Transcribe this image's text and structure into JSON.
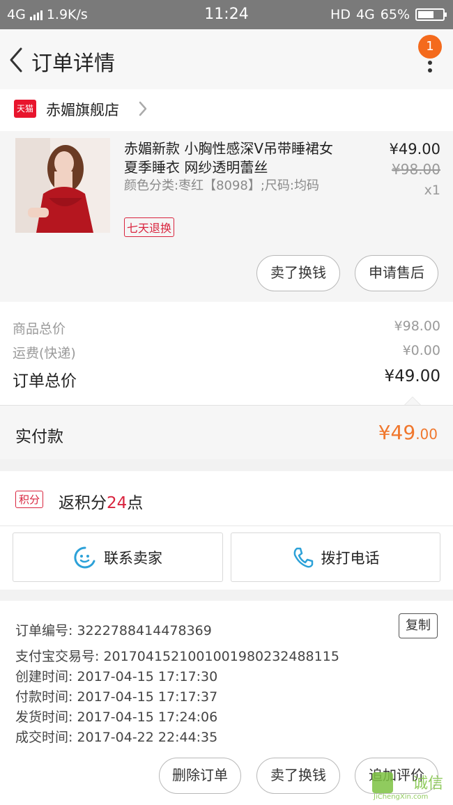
{
  "status_bar": {
    "network": "4G",
    "speed": "1.9K/s",
    "time": "11:24",
    "hd": "HD",
    "network_right": "4G",
    "battery": "65%"
  },
  "nav": {
    "title": "订单详情",
    "badge": "1"
  },
  "store": {
    "badge": "天猫",
    "name": "赤媚旗舰店"
  },
  "product": {
    "title": "赤媚新款 小胸性感深V吊带睡裙女 夏季睡衣 网纱透明蕾丝",
    "spec": "颜色分类:枣红【8098】;尺码:均码",
    "tag": "七天退换",
    "price": "¥49.00",
    "original_price": "¥98.00",
    "quantity": "x1",
    "buttons": [
      "卖了换钱",
      "申请售后"
    ]
  },
  "summary": {
    "rows": [
      {
        "label": "商品总价",
        "value": "¥98.00"
      },
      {
        "label": "运费(快递)",
        "value": "¥0.00"
      }
    ],
    "total_label": "订单总价",
    "total_value": "¥49.00"
  },
  "paid": {
    "label": "实付款",
    "amount_main": "¥49",
    "amount_decimal": ".00"
  },
  "points": {
    "tag": "积分",
    "prefix": "返积分",
    "value": "24",
    "suffix": "点"
  },
  "contact": {
    "seller": "联系卖家",
    "call": "拨打电话"
  },
  "order_info": {
    "copy_button": "复制",
    "lines": [
      "订单编号: 3222788414478369",
      "支付宝交易号: 2017041521001001980232488115",
      "创建时间: 2017-04-15 17:17:30",
      "付款时间: 2017-04-15 17:17:37",
      "发货时间: 2017-04-15 17:24:06",
      "成交时间: 2017-04-22 22:44:35"
    ]
  },
  "bottom_actions": [
    "删除订单",
    "卖了换钱",
    "追加评价"
  ],
  "watermark": {
    "text": "诚信",
    "subtext": "JiChengXin.com"
  },
  "colors": {
    "accent_red": "#d9243e",
    "accent_orange": "#f0772d",
    "badge_orange": "#f46a1c",
    "status_bar": "#7a7a7a"
  }
}
